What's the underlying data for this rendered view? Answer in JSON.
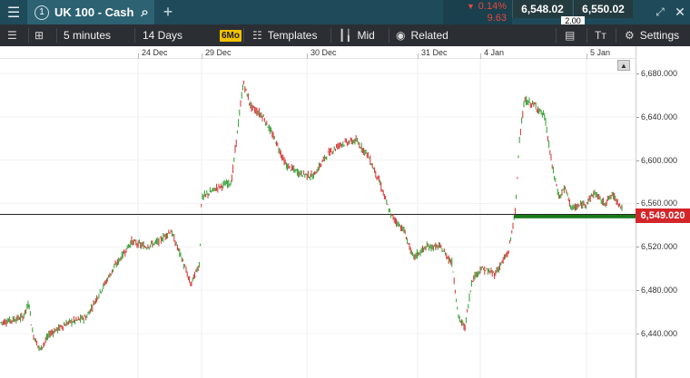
{
  "header": {
    "menu_icon": "hamburger-icon",
    "tab_number": "1",
    "instrument": "UK 100 - Cash",
    "search_icon": "search-icon",
    "add_icon": "plus-icon",
    "change_pct": "0.14%",
    "change_abs": "9.63",
    "change_direction": "down",
    "sell_price": "6,548.02",
    "buy_price": "6,550.02",
    "spread": "2.00",
    "expand_icon": "expand-icon",
    "close_icon": "close-icon"
  },
  "toolbar": {
    "layout_icon": "list-icon",
    "grid_icon": "grid-icon",
    "interval": "5 minutes",
    "range": "14 Days",
    "badge": "6Mo",
    "templates_label": "Templates",
    "mid_label": "Mid",
    "related_label": "Related",
    "text_icon": "text-size-icon",
    "settings_label": "Settings"
  },
  "colors": {
    "up": "#2e9b2e",
    "down": "#d32f2f",
    "accent_bar": "#1f4a5a",
    "price_tag": "#d3262a",
    "level_line": "#1c7a1c"
  },
  "chart_data": {
    "type": "candlestick",
    "x_labels": [
      "24 Dec",
      "29 Dec",
      "30 Dec",
      "31 Dec",
      "4 Jan",
      "5 Jan"
    ],
    "y_ticks": [
      "6,680.000",
      "6,640.000",
      "6,600.000",
      "6,560.000",
      "6,520.000",
      "6,480.000",
      "6,440.000"
    ],
    "y_tick_values": [
      6680,
      6640,
      6600,
      6560,
      6520,
      6480,
      6440
    ],
    "ylim": [
      6423,
      6698
    ],
    "current_price": "6,549.020",
    "current_price_value": 6549.02,
    "horizontal_line_value": 6550,
    "price_path": [
      [
        0,
        6450
      ],
      [
        25,
        6455
      ],
      [
        32,
        6468
      ],
      [
        36,
        6440
      ],
      [
        44,
        6425
      ],
      [
        55,
        6440
      ],
      [
        75,
        6450
      ],
      [
        95,
        6455
      ],
      [
        108,
        6475
      ],
      [
        125,
        6500
      ],
      [
        145,
        6525
      ],
      [
        160,
        6520
      ],
      [
        175,
        6525
      ],
      [
        188,
        6535
      ],
      [
        200,
        6510
      ],
      [
        210,
        6485
      ],
      [
        220,
        6505
      ],
      [
        222,
        6565
      ],
      [
        240,
        6575
      ],
      [
        255,
        6580
      ],
      [
        262,
        6630
      ],
      [
        268,
        6672
      ],
      [
        276,
        6650
      ],
      [
        290,
        6640
      ],
      [
        305,
        6615
      ],
      [
        315,
        6595
      ],
      [
        330,
        6588
      ],
      [
        345,
        6585
      ],
      [
        360,
        6605
      ],
      [
        375,
        6615
      ],
      [
        392,
        6618
      ],
      [
        405,
        6605
      ],
      [
        418,
        6580
      ],
      [
        430,
        6550
      ],
      [
        445,
        6535
      ],
      [
        455,
        6510
      ],
      [
        470,
        6520
      ],
      [
        485,
        6520
      ],
      [
        498,
        6505
      ],
      [
        505,
        6455
      ],
      [
        512,
        6445
      ],
      [
        520,
        6490
      ],
      [
        530,
        6500
      ],
      [
        545,
        6495
      ],
      [
        560,
        6515
      ],
      [
        568,
        6555
      ],
      [
        572,
        6620
      ],
      [
        578,
        6655
      ],
      [
        590,
        6650
      ],
      [
        600,
        6640
      ],
      [
        608,
        6595
      ],
      [
        616,
        6565
      ],
      [
        622,
        6575
      ],
      [
        630,
        6555
      ],
      [
        645,
        6560
      ],
      [
        655,
        6570
      ],
      [
        665,
        6560
      ],
      [
        675,
        6568
      ],
      [
        686,
        6555
      ]
    ]
  }
}
